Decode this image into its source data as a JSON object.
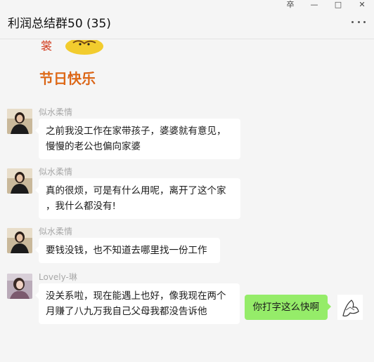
{
  "window": {
    "title": "利润总结群50 (35)",
    "controls": {
      "pin": "卒",
      "minimize": "—",
      "maximize": "□",
      "close": "✕"
    }
  },
  "sticker": {
    "text": "节日快乐"
  },
  "messages": [
    {
      "sender": "似水柔情",
      "lines": [
        "之前我没工作在家带孩子，婆婆就有意见，",
        "慢慢的老公也偏向家婆"
      ]
    },
    {
      "sender": "似水柔情",
      "lines": [
        "真的很烦，可是有什么用呢，离开了这个家",
        "，我什么都没有!"
      ]
    },
    {
      "sender": "似水柔情",
      "lines": [
        "要钱没钱，也不知道去哪里找一份工作"
      ]
    },
    {
      "sender": "Lovely-琳",
      "lines": [
        "没关系啦，现在能遇上也好，像我现在两个",
        "月赚了八九万我自己父母我都没告诉他"
      ]
    }
  ],
  "my_message": {
    "text": "你打字这么快啊"
  },
  "colors": {
    "my_bubble": "#95ec69",
    "other_bubble": "#ffffff",
    "background": "#f5f5f5"
  }
}
